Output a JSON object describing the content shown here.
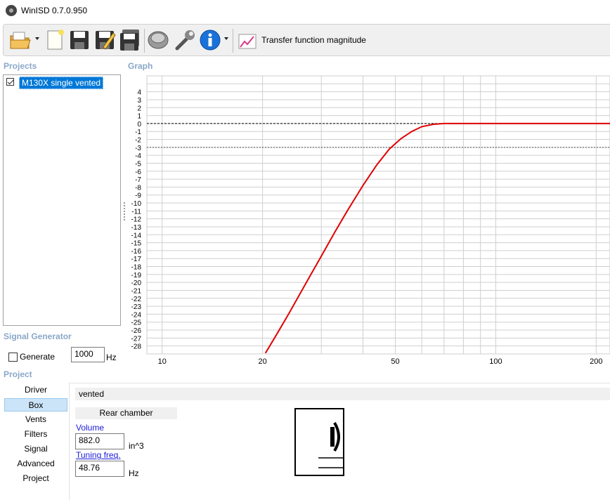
{
  "window": {
    "title": "WinISD 0.7.0.950"
  },
  "toolbar": {
    "buttons": [
      {
        "name": "open-folder-icon",
        "color": "#e8a93a"
      },
      {
        "name": "new-document-icon",
        "color": "#fffef4"
      },
      {
        "name": "save-icon",
        "color": "#333333"
      },
      {
        "name": "save-as-icon",
        "color": "#333333"
      },
      {
        "name": "save-all-icon",
        "color": "#333333"
      },
      {
        "name": "driver-icon",
        "color": "#888888"
      },
      {
        "name": "wrench-icon",
        "color": "#777777"
      },
      {
        "name": "info-icon",
        "color": "#1a72d9"
      },
      {
        "name": "graph-icon",
        "color": "#d93a8a"
      }
    ],
    "graph_selector_label": "Transfer function magnitude"
  },
  "projects": {
    "header": "Projects",
    "items": [
      {
        "name": "M130X single vented",
        "checked": true,
        "selected": true
      }
    ]
  },
  "graph": {
    "header": "Graph",
    "line_color": "#e00000",
    "chart_data": {
      "type": "line",
      "title": "",
      "xlabel": "",
      "ylabel": "",
      "x_scale": "log",
      "xlim": [
        9,
        220
      ],
      "ylim": [
        -29,
        6
      ],
      "x_ticks": [
        "10",
        "20",
        "50",
        "100",
        "200"
      ],
      "y_ticks": [
        "4",
        "3",
        "2",
        "1",
        "0",
        "-1",
        "-2",
        "-3",
        "-4",
        "-5",
        "-6",
        "-7",
        "-8",
        "-9",
        "-10",
        "-11",
        "-12",
        "-13",
        "-14",
        "-15",
        "-16",
        "-17",
        "-18",
        "-19",
        "-20",
        "-21",
        "-22",
        "-23",
        "-24",
        "-25",
        "-26",
        "-27",
        "-28"
      ],
      "reference_lines": [
        0,
        -3
      ],
      "grid": true,
      "series": [
        {
          "x": [
            20.4,
            22,
            24,
            26,
            28,
            30,
            33,
            36,
            40,
            44,
            48,
            52,
            56,
            60,
            65,
            70,
            80,
            100,
            150,
            220
          ],
          "y": [
            -28.9,
            -26.6,
            -23.9,
            -21.3,
            -18.9,
            -16.7,
            -13.6,
            -10.9,
            -7.8,
            -5.2,
            -3.2,
            -1.9,
            -1.0,
            -0.4,
            -0.1,
            0,
            0,
            0,
            0,
            0
          ]
        }
      ]
    }
  },
  "signal_generator": {
    "header": "Signal Generator",
    "generate_label": "Generate",
    "generate_checked": false,
    "frequency": "1000",
    "unit": "Hz"
  },
  "project": {
    "header": "Project",
    "tabs": [
      {
        "label": "Driver",
        "active": false
      },
      {
        "label": "Box",
        "active": true
      },
      {
        "label": "Vents",
        "active": false
      },
      {
        "label": "Filters",
        "active": false
      },
      {
        "label": "Signal",
        "active": false
      },
      {
        "label": "Advanced",
        "active": false
      },
      {
        "label": "Project",
        "active": false
      }
    ],
    "box_type": "vented",
    "rear_chamber_label": "Rear chamber",
    "volume": {
      "label": "Volume",
      "value": "882.0",
      "unit": "in^3"
    },
    "tuning": {
      "label": "Tuning freq.",
      "value": "48.76",
      "unit": "Hz"
    }
  }
}
